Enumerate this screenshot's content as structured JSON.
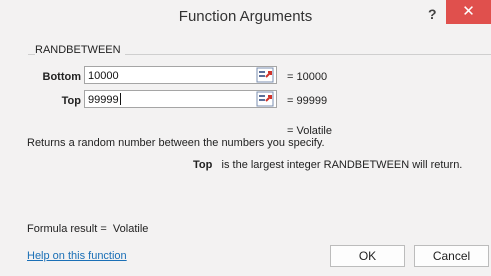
{
  "window": {
    "title": "Function Arguments",
    "help_glyph": "?",
    "close_glyph": "✕"
  },
  "function_name": "RANDBETWEEN",
  "arguments": [
    {
      "label": "Bottom",
      "value": "10000",
      "result": "10000"
    },
    {
      "label": "Top",
      "value": "99999",
      "result": "99999"
    }
  ],
  "function_result_line": "Volatile",
  "description": "Returns a random number between the numbers you specify.",
  "arg_help": {
    "name": "Top",
    "text": "is the largest integer RANDBETWEEN will return."
  },
  "formula_result": {
    "label": "Formula result =",
    "value": "Volatile"
  },
  "help_link": "Help on this function",
  "buttons": {
    "ok": "OK",
    "cancel": "Cancel"
  },
  "colors": {
    "close_button": "#e0504d",
    "link": "#1a6fb6",
    "background": "#f3f2f2"
  }
}
